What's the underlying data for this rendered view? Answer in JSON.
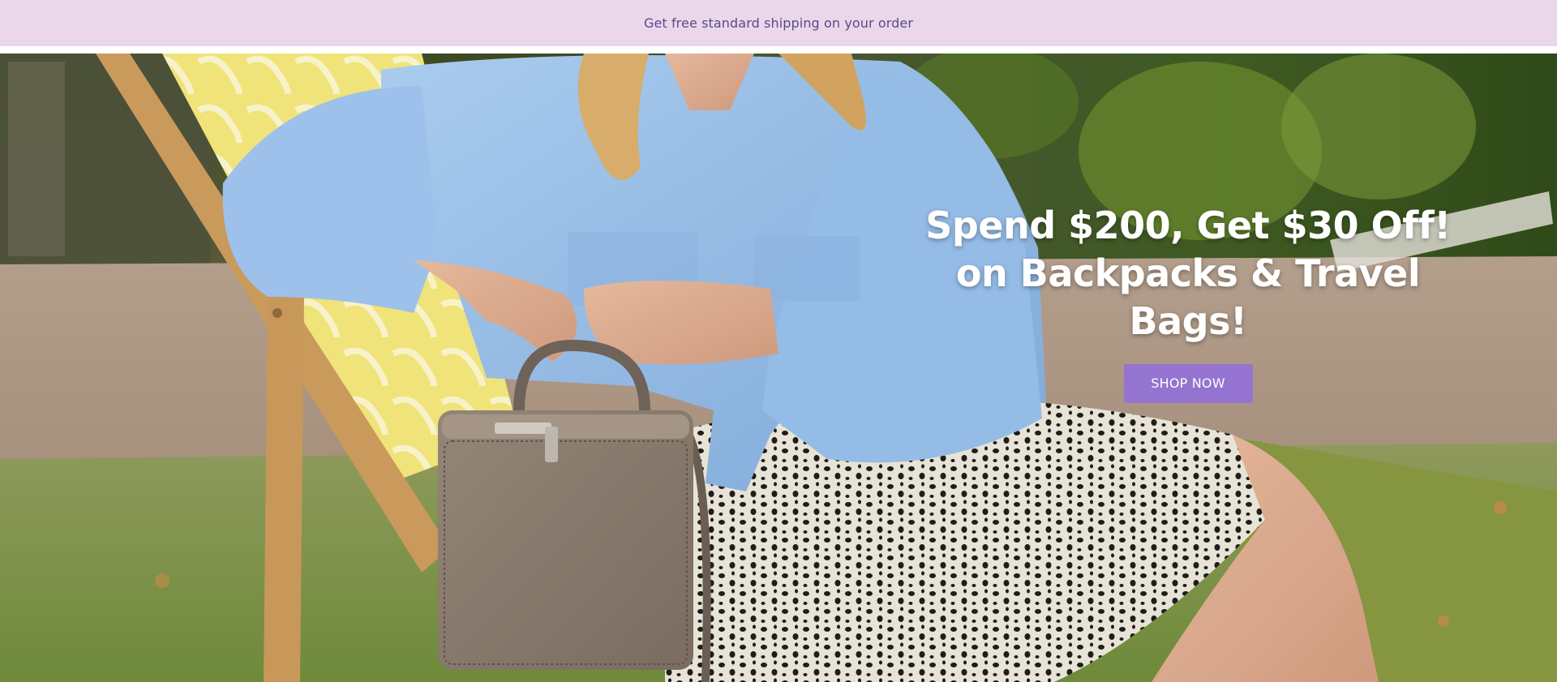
{
  "announcement": {
    "text": "Get free standard shipping on your order"
  },
  "hero": {
    "heading_line_1": "Spend $200, Get $30 Off!",
    "heading_line_2": "on Backpacks & Travel Bags!",
    "cta_label": "SHOP NOW",
    "image_label": "woman in deck chair holding handbag"
  },
  "colors": {
    "announcement_bg": "#ead7ea",
    "announcement_text": "#5a4a8a",
    "cta_bg": "#9474d0",
    "heading_text": "#ffffff"
  }
}
